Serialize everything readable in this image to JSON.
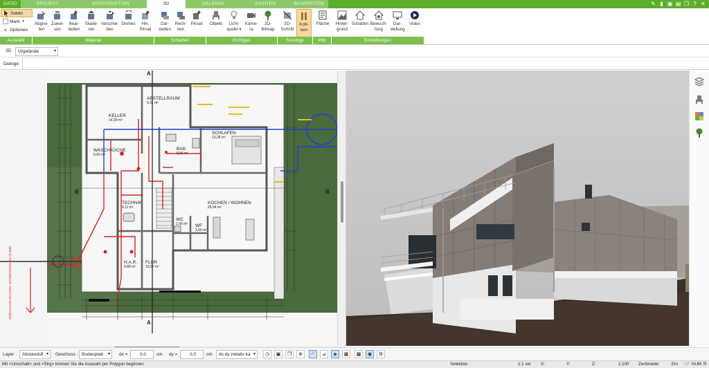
{
  "tabs": [
    {
      "label": "DATEI"
    },
    {
      "label": "PROJEKT"
    },
    {
      "label": "KONSTRUKTION"
    },
    {
      "label": "3D"
    },
    {
      "label": "GELÄNDE"
    },
    {
      "label": "SICHTEN"
    },
    {
      "label": "BEARBEITEN"
    }
  ],
  "selection_tools": {
    "select": "Selekt",
    "mark": "Mark.",
    "options": "Optionen"
  },
  "ribbon": {
    "material": [
      {
        "l1": "Abgrei-",
        "l2": "fen",
        "icon": "eyedropper-icon"
      },
      {
        "l1": "Zuwei-",
        "l2": "sen",
        "icon": "paint-bucket-icon"
      },
      {
        "l1": "Bear-",
        "l2": "beiten",
        "icon": "brush-icon"
      },
      {
        "l1": "Skalie-",
        "l2": "ren",
        "icon": "scale-icon"
      },
      {
        "l1": "Verschie-",
        "l2": "ben",
        "icon": "move-icon"
      },
      {
        "l1": "Drehen",
        "l2": "",
        "icon": "rotate-icon"
      },
      {
        "l1": "Hin.",
        "l2": "Pinsel",
        "icon": "brush-bg-icon"
      }
    ],
    "schatten": [
      {
        "l1": "Dar-",
        "l2": "stellen",
        "icon": "shadow-display-icon"
      },
      {
        "l1": "Rech-",
        "l2": "nen",
        "icon": "shadow-calc-icon"
      },
      {
        "l1": "Pinsel",
        "l2": "",
        "icon": "shadow-brush-icon"
      }
    ],
    "einfuegen": [
      {
        "l1": "Objekt",
        "l2": "",
        "icon": "chair-icon"
      },
      {
        "l1": "Licht-",
        "l2": "quelle ▾",
        "icon": "light-bulb-icon"
      },
      {
        "l1": "Kame-",
        "l2": "ra",
        "icon": "camera-icon"
      },
      {
        "l1": "3D-",
        "l2": "Bitmap",
        "icon": "tree-icon"
      }
    ],
    "sonstige": [
      {
        "l1": "3D-",
        "l2": "Schnitt",
        "icon": "section-icon"
      },
      {
        "l1": "Kolli-",
        "l2": "sion",
        "icon": "collision-icon"
      }
    ],
    "info": [
      {
        "l1": "Fläche",
        "l2": "",
        "icon": "area-icon"
      }
    ],
    "einstellungen": [
      {
        "l1": "Hinter-",
        "l2": "grund",
        "icon": "background-icon"
      },
      {
        "l1": "Schatten",
        "l2": "",
        "icon": "house-shadow-icon"
      },
      {
        "l1": "Beleuch-",
        "l2": "tung",
        "icon": "house-light-icon"
      },
      {
        "l1": "Dar-",
        "l2": "stellung",
        "icon": "monitor-icon"
      },
      {
        "l1": "Video",
        "l2": "",
        "icon": "play-icon"
      }
    ],
    "groups": {
      "auswahl": "Auswahl",
      "material": "Material",
      "schatten": "Schatten",
      "einfuegen": "Einfügen",
      "sonstige": "Sonstige",
      "info": "Info",
      "einstellungen": "Einstellungen"
    }
  },
  "toolbar": {
    "view_mode": "3D",
    "terrain_combo": "Urgelände",
    "dialoge_label": "Dialoge:"
  },
  "plan": {
    "rooms": [
      {
        "name": "KELLER",
        "area": "14,09 m²"
      },
      {
        "name": "ABSTELLRAUM",
        "area": "6,31 m²"
      },
      {
        "name": "SCHLAFEN",
        "area": "13,28 m²"
      },
      {
        "name": "BAD",
        "area": "8,56 m²"
      },
      {
        "name": "WASCHKÜCHE",
        "area": "6,69 m²"
      },
      {
        "name": "KOCHEN / WOHNEN",
        "area": "26,94 m²"
      },
      {
        "name": "TECHNIK",
        "area": "4,11 m²"
      },
      {
        "name": "WC",
        "area": "2,06 m²"
      },
      {
        "name": "WF",
        "area": "3,60 m²"
      },
      {
        "name": "H.A.R.",
        "area": "4,86 m²"
      },
      {
        "name": "FLUR",
        "area": "10,07 m²"
      }
    ],
    "section_a": "A",
    "section_b": "B",
    "side_note": "ANSCHLUSS AN VORH. ENTWÄSSERUNG (S.400)"
  },
  "bottombar": {
    "layer_label": "Layer :",
    "layer_value": "Abstandsfl",
    "geschoss_label": "Geschoss :",
    "geschoss_value": "Bodenplatt",
    "dx_label": "dx =",
    "dx_value": "0,0",
    "dy_label": "dy =",
    "dy_value": "0,0",
    "unit": "cm",
    "mode_value": "dx,dy (relativ ka"
  },
  "status": {
    "hint": "Mit <Umschalt> und <Strg> können Sie die Auswahl per Polygon beginnen",
    "mode": "Selektion",
    "sel": "1:1 sel",
    "x": "X:",
    "y": "Y:",
    "z": "Z:",
    "scale": "1:100",
    "unit": "Zentimeter",
    "ein": "Ein",
    "uf": "UF",
    "num": "NUM",
    "r": "R"
  },
  "colors": {
    "tab_green": "#5cae2b",
    "group_green": "#7cc04c",
    "active_orange": "#f6d79e",
    "plan_grass": "#4a6b3e",
    "wall_red": "#e02020",
    "wall_blue": "#2040d0"
  }
}
